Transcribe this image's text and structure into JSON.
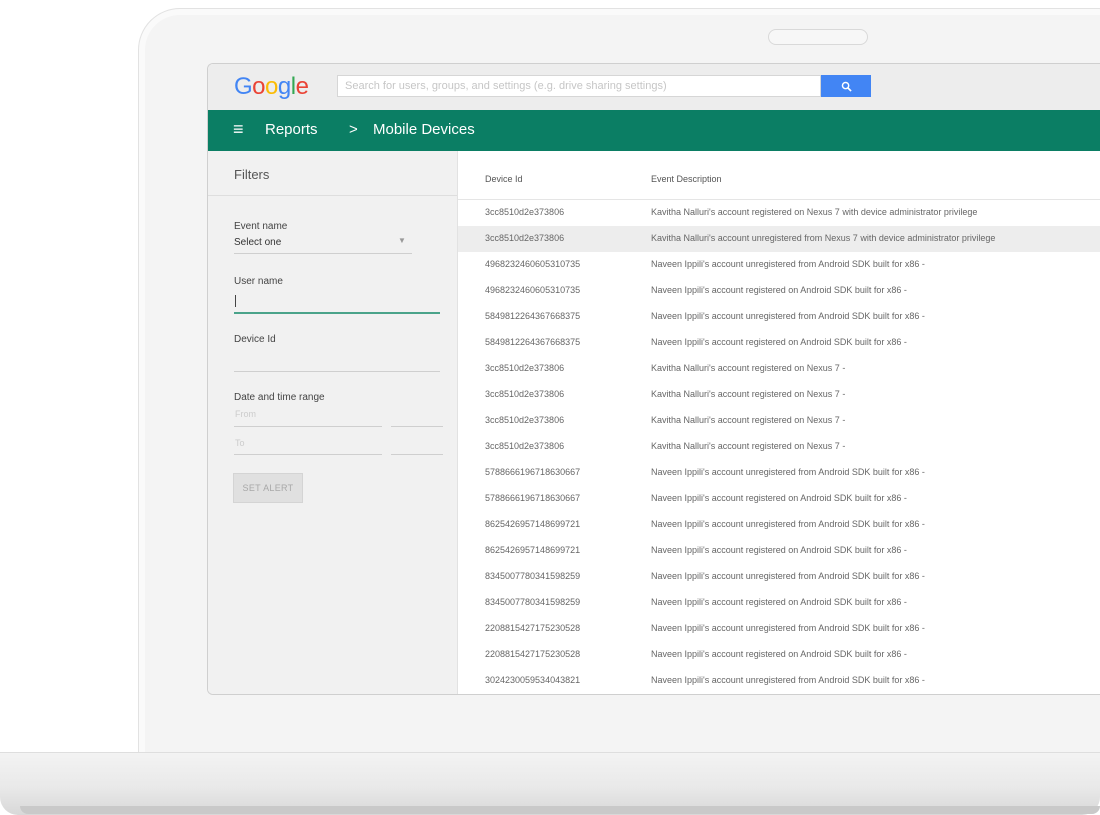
{
  "header": {
    "logo": "Google",
    "logo_colors": [
      "#4285f4",
      "#ea4335",
      "#fbbc05",
      "#4285f4",
      "#34a853",
      "#ea4335"
    ],
    "search_placeholder": "Search for users, groups, and settings (e.g. drive sharing settings)",
    "search_button_icon": "search-icon"
  },
  "nav": {
    "menu_icon": "≡",
    "breadcrumb_root": "Reports",
    "breadcrumb_separator": ">",
    "breadcrumb_current": "Mobile Devices",
    "color": "#0b7e64"
  },
  "filters": {
    "title": "Filters",
    "event_name_label": "Event name",
    "event_name_value": "Select one",
    "user_name_label": "User name",
    "device_id_label": "Device Id",
    "date_range_label": "Date and time range",
    "from_placeholder": "From",
    "to_placeholder": "To",
    "alert_button": "SET ALERT"
  },
  "table": {
    "columns": [
      "Device Id",
      "Event Description"
    ],
    "highlighted_row": 1,
    "rows": [
      {
        "id": "3cc8510d2e373806",
        "event": "Kavitha Nalluri's account registered on Nexus 7 with device administrator privilege"
      },
      {
        "id": "3cc8510d2e373806",
        "event": "Kavitha Nalluri's account unregistered from Nexus 7 with device administrator privilege"
      },
      {
        "id": "4968232460605310735",
        "event": "Naveen Ippili's account unregistered from Android SDK built for x86 -"
      },
      {
        "id": "4968232460605310735",
        "event": "Naveen Ippili's account registered on Android SDK built for x86 -"
      },
      {
        "id": "5849812264367668375",
        "event": "Naveen Ippili's account unregistered from Android SDK built for x86 -"
      },
      {
        "id": "5849812264367668375",
        "event": "Naveen Ippili's account registered on Android SDK built for x86 -"
      },
      {
        "id": "3cc8510d2e373806",
        "event": "Kavitha Nalluri's account registered on Nexus 7 -"
      },
      {
        "id": "3cc8510d2e373806",
        "event": "Kavitha Nalluri's account registered on Nexus 7 -"
      },
      {
        "id": "3cc8510d2e373806",
        "event": "Kavitha Nalluri's account registered on Nexus 7 -"
      },
      {
        "id": "3cc8510d2e373806",
        "event": "Kavitha Nalluri's account registered on Nexus 7 -"
      },
      {
        "id": "5788666196718630667",
        "event": "Naveen Ippili's account unregistered from Android SDK built for x86 -"
      },
      {
        "id": "5788666196718630667",
        "event": "Naveen Ippili's account registered on Android SDK built for x86 -"
      },
      {
        "id": "8625426957148699721",
        "event": "Naveen Ippili's account unregistered from Android SDK built for x86 -"
      },
      {
        "id": "8625426957148699721",
        "event": "Naveen Ippili's account registered on Android SDK built for x86 -"
      },
      {
        "id": "8345007780341598259",
        "event": "Naveen Ippili's account unregistered from Android SDK built for x86 -"
      },
      {
        "id": "8345007780341598259",
        "event": "Naveen Ippili's account registered on Android SDK built for x86 -"
      },
      {
        "id": "2208815427175230528",
        "event": "Naveen Ippili's account unregistered from Android SDK built for x86 -"
      },
      {
        "id": "2208815427175230528",
        "event": "Naveen Ippili's account registered on Android SDK built for x86 -"
      },
      {
        "id": "3024230059534043821",
        "event": "Naveen Ippili's account unregistered from Android SDK built for x86 -"
      }
    ]
  }
}
